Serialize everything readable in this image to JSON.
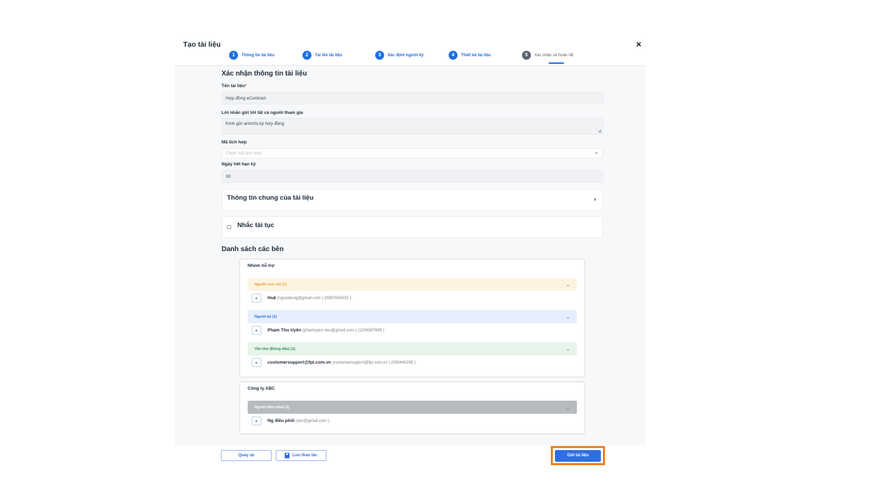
{
  "modal": {
    "title": "Tạo tài liệu",
    "close_symbol": "×"
  },
  "stepper": {
    "steps": [
      {
        "number": "1",
        "label": "Thông tin tài liệu"
      },
      {
        "number": "2",
        "label": "Tải lên tài liệu"
      },
      {
        "number": "3",
        "label": "Xác định người ký"
      },
      {
        "number": "4",
        "label": "Thiết kế tài liệu"
      },
      {
        "number": "5",
        "label": "Xác nhận và hoàn tất"
      }
    ]
  },
  "form": {
    "section_title": "Xác nhận thông tin tài liệu",
    "doc_name_label": "Tên tài liệu",
    "required_mark": "*",
    "doc_name_value": "Hợp đồng eContract",
    "message_label": "Lời nhắn gửi tới tất cả người tham gia",
    "message_value": "Kính gửi anh/chị ký hợp đồng",
    "integration_code_label": "Mã tích hợp",
    "integration_code_placeholder": "Chọn mã tích hợp",
    "expiry_label": "Ngày hết hạn ký",
    "expiry_value": "30",
    "general_info_title": "Thông tin chung của tài liệu",
    "renewal_reminder_label": "Nhắc tái tục"
  },
  "parties": {
    "title": "Danh sách các bên",
    "groups": [
      {
        "name": "Nhóm hỗ trợ",
        "roles": [
          {
            "label": "Người xem xét (1)",
            "member_name": "Huệ",
            "member_meta": "(nguoidung@gmail.com ) (0987654332 )"
          },
          {
            "label": "Người ký (1)",
            "member_name": "Phạm Thu Uyên",
            "member_meta": "(phamuyen.neu@gmail.com ) (1234567899 )"
          },
          {
            "label": "Văn thư (Đóng dấu) (1)",
            "member_name": "customersupport@fpt.com.vn",
            "member_meta": "(customersupport@fpt.com.vn ) (093440299 )"
          }
        ]
      },
      {
        "name": "Công ty ABC",
        "roles": [
          {
            "label": "Người điều phối (1)",
            "member_name": "Ng điều phối",
            "member_meta": "(abc@gmail.com )"
          }
        ]
      }
    ]
  },
  "footer": {
    "back_label": "Quay lại",
    "save_label": "Lưu thao tác",
    "submit_label": "Gửi tài liệu"
  },
  "colors": {
    "primary": "#2f6fe0",
    "highlight": "#f07d21",
    "viewer_bg": "#fdf3e2",
    "signer_bg": "#e6efff",
    "clerk_bg": "#e6f4ea",
    "coordinator_bg": "#b7babe"
  },
  "icons": [
    "close-icon",
    "chevron-right-icon",
    "chevron-down-icon",
    "caret-down-icon",
    "save-icon",
    "expand-icon"
  ]
}
